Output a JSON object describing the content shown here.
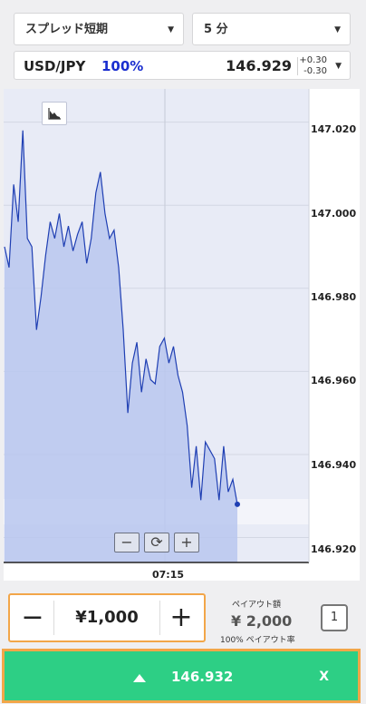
{
  "header": {
    "product_label": "スプレッド短期",
    "period_label": "5 分",
    "dropdown_arrow": "▼"
  },
  "quote": {
    "pair": "USD/JPY",
    "payout_pct": "100%",
    "price": "146.929",
    "spread_up": "+0.30",
    "spread_down": "-0.30"
  },
  "chart_data": {
    "type": "area",
    "y_ticks": [
      "147.020",
      "147.000",
      "146.980",
      "146.960",
      "146.940",
      "146.920"
    ],
    "x_ticks": [
      "07:15"
    ],
    "ylim": [
      146.914,
      147.028
    ],
    "colors": {
      "line": "#1f3fb3",
      "fill": "#b9c7ee",
      "plot_bg": "#e8ebf6"
    },
    "series": [
      {
        "values": [
          146.99,
          146.985,
          147.005,
          146.996,
          147.018,
          146.992,
          146.99,
          146.97,
          146.978,
          146.988,
          146.996,
          146.992,
          146.998,
          146.99,
          146.995,
          146.989,
          146.993,
          146.996,
          146.986,
          146.992,
          147.003,
          147.008,
          146.998,
          146.992,
          146.994,
          146.985,
          146.97,
          146.95,
          146.962,
          146.967,
          146.955,
          146.963,
          146.958,
          146.957,
          146.966,
          146.968,
          146.962,
          146.966,
          146.959,
          146.955,
          146.947,
          146.932,
          146.942,
          146.929,
          146.943,
          146.941,
          146.939,
          146.929,
          146.942,
          146.931,
          146.934,
          146.928
        ]
      }
    ]
  },
  "chart_controls": {
    "chart_type_icon": "area-chart-icon",
    "zoom_out": "−",
    "reset": "⟳",
    "zoom_in": "+"
  },
  "order": {
    "amount": "¥1,000",
    "minus": "−",
    "plus": "+",
    "payout_label": "ペイアウト額",
    "payout_value": "¥ 2,000",
    "payout_rate": "100% ペイアウト率",
    "count": "1"
  },
  "trade_button": {
    "price": "146.932",
    "close": "X",
    "color": "#2dcf85"
  }
}
